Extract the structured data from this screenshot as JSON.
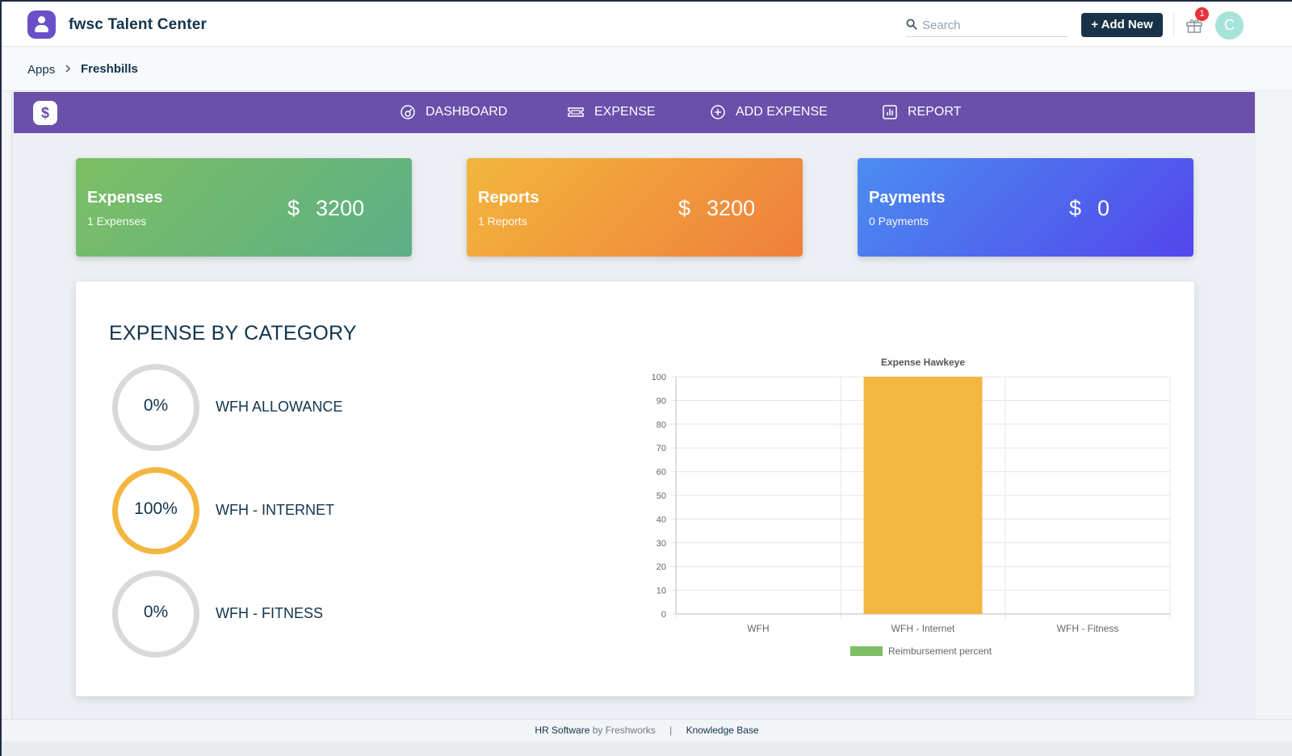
{
  "header": {
    "app_title": "fwsc Talent Center",
    "search_placeholder": "Search",
    "add_new_label": "+ Add New",
    "notification_count": "1",
    "avatar_initial": "C"
  },
  "breadcrumb": {
    "root": "Apps",
    "current": "Freshbills"
  },
  "navbar": {
    "logo_symbol": "$",
    "items": [
      {
        "label": "DASHBOARD",
        "icon": "dashboard-gauge-icon"
      },
      {
        "label": "EXPENSE",
        "icon": "ticket-icon"
      },
      {
        "label": "ADD EXPENSE",
        "icon": "plus-circle-icon"
      },
      {
        "label": "REPORT",
        "icon": "bar-report-icon"
      }
    ]
  },
  "cards": [
    {
      "title": "Expenses",
      "subtitle": "1 Expenses",
      "currency": "$",
      "amount": "3200",
      "color_start": "#7cbf64",
      "color_end": "#5daf86"
    },
    {
      "title": "Reports",
      "subtitle": "1 Reports",
      "currency": "$",
      "amount": "3200",
      "color_start": "#f2b63c",
      "color_end": "#f07f3c"
    },
    {
      "title": "Payments",
      "subtitle": "0 Payments",
      "currency": "$",
      "amount": "0",
      "color_start": "#4b8df0",
      "color_end": "#5346ec"
    }
  ],
  "panel": {
    "title": "EXPENSE BY CATEGORY",
    "categories": [
      {
        "percent": "0%",
        "label": "WFH ALLOWANCE",
        "active": false
      },
      {
        "percent": "100%",
        "label": "WFH - INTERNET",
        "active": true
      },
      {
        "percent": "0%",
        "label": "WFH - FITNESS",
        "active": false
      }
    ]
  },
  "chart_data": {
    "type": "bar",
    "title": "Expense Hawkeye",
    "categories": [
      "WFH",
      "WFH - Internet",
      "WFH - Fitness"
    ],
    "series": [
      {
        "name": "Reimbursement percent",
        "values": [
          0,
          100,
          0
        ],
        "color": "#f3b63f"
      }
    ],
    "legend_color": "#7dbd64",
    "ylim": [
      0,
      100
    ],
    "yticks": [
      0,
      10,
      20,
      30,
      40,
      50,
      60,
      70,
      80,
      90,
      100
    ],
    "grid": true,
    "legend": "bottom"
  },
  "footer": {
    "product": "HR Software",
    "by": "by Freshworks",
    "separator": "|",
    "kb_link": "Knowledge Base"
  },
  "colors": {
    "brand_purple": "#6a4fab",
    "primary_dark": "#183247",
    "accent_yellow": "#f3b63f"
  }
}
